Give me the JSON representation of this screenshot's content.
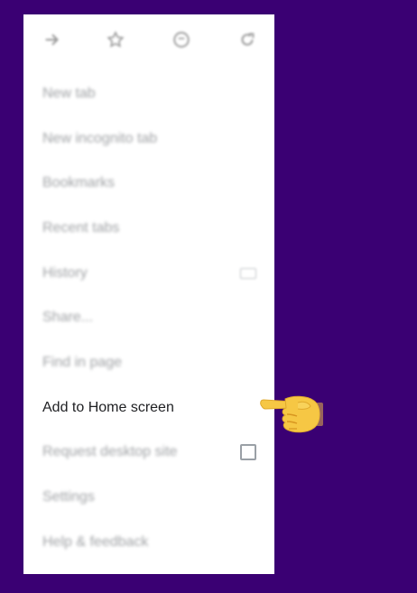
{
  "toolbar": {
    "icons": [
      "forward-icon",
      "star-icon",
      "info-icon",
      "refresh-icon"
    ]
  },
  "menu": {
    "items": [
      {
        "label": "New tab"
      },
      {
        "label": "New incognito tab"
      },
      {
        "label": "Bookmarks"
      },
      {
        "label": "Recent tabs"
      },
      {
        "label": "History"
      },
      {
        "label": "Share..."
      },
      {
        "label": "Find in page"
      },
      {
        "label": "Add to Home screen"
      },
      {
        "label": "Request desktop site"
      },
      {
        "label": "Settings"
      },
      {
        "label": "Help & feedback"
      }
    ]
  },
  "colors": {
    "background": "#3a0073",
    "menu": "#ffffff",
    "focused_text": "#202124",
    "muted_text": "#5f6368",
    "pointer": "#f6c744"
  },
  "pointer": {
    "icon": "pointing-hand-icon",
    "target": "Add to Home screen"
  }
}
